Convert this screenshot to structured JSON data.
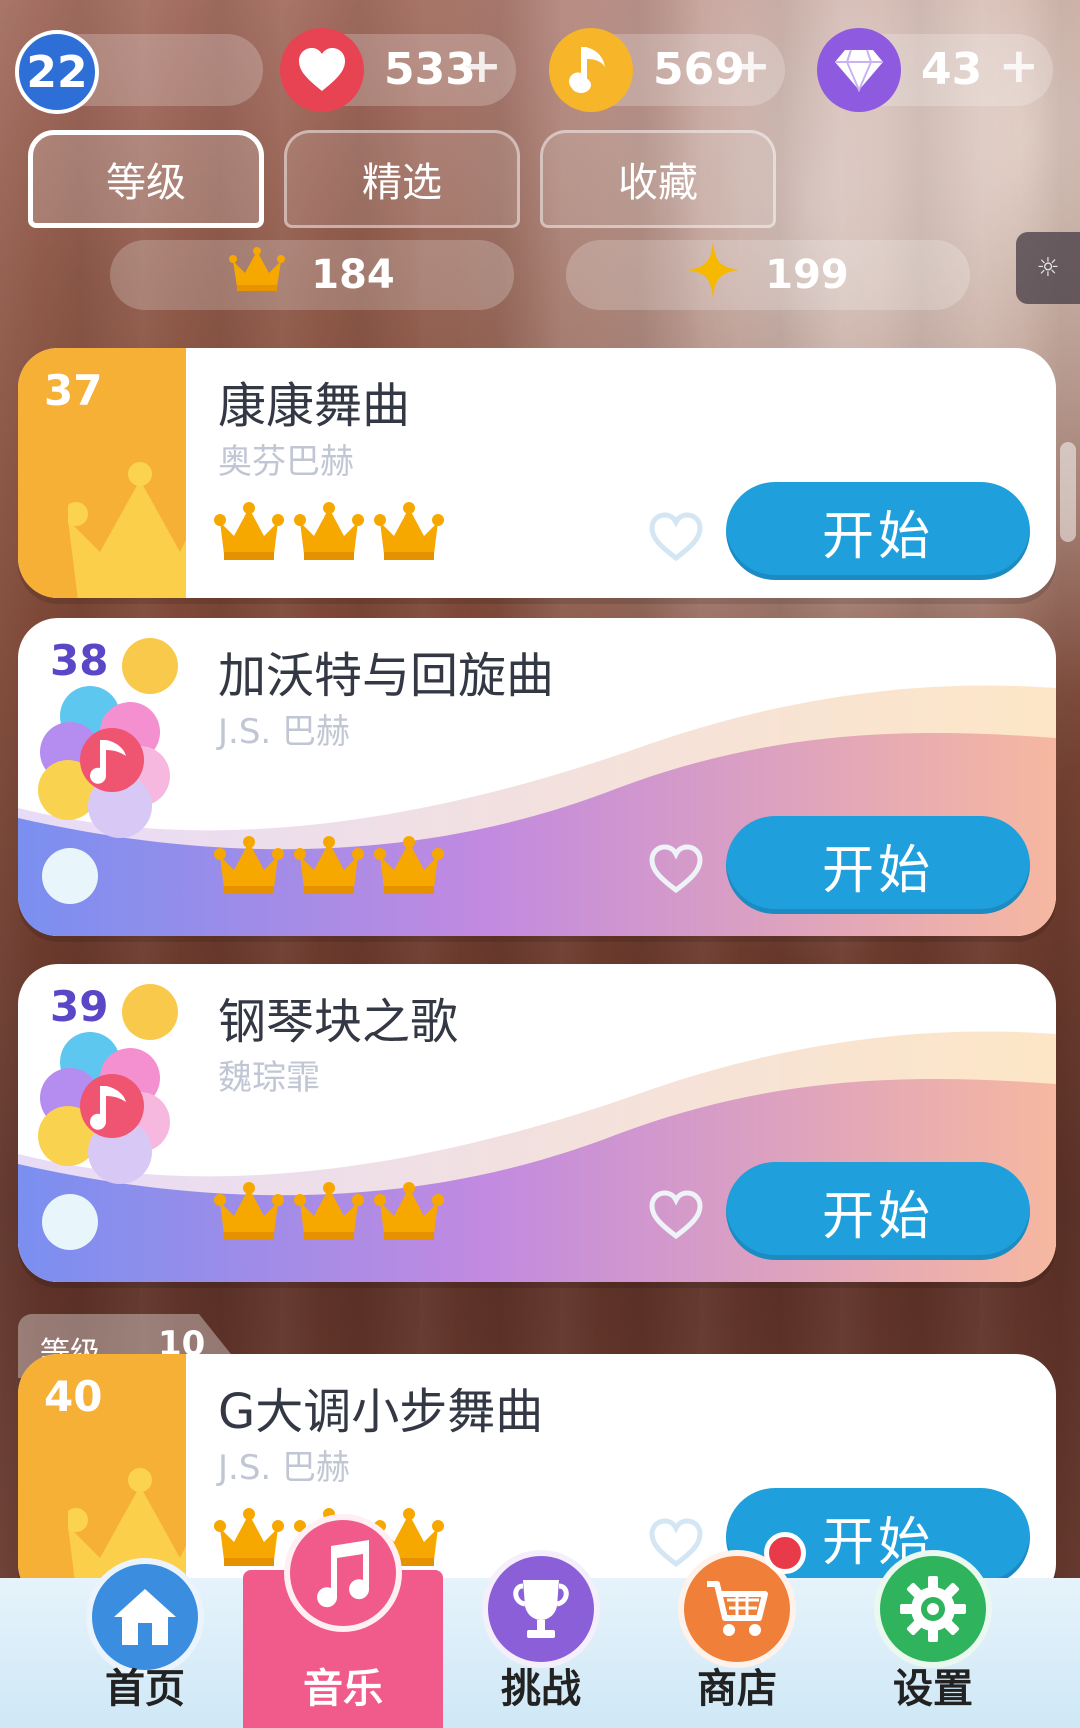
{
  "status": {
    "level": "22",
    "lives": {
      "value": "533",
      "plus": "+",
      "color": "#e84352"
    },
    "notes": {
      "value": "569",
      "plus": "+",
      "color": "#f7b52a"
    },
    "gems": {
      "value": "43",
      "plus": "+",
      "color": "#8e5ae0"
    }
  },
  "tabs": [
    {
      "label": "等级"
    },
    {
      "label": "精选"
    },
    {
      "label": "收藏"
    }
  ],
  "totals": {
    "crowns": "184",
    "stars": "199"
  },
  "songs": [
    {
      "num": "37",
      "title": "康康舞曲",
      "artist": "奥芬巴赫",
      "crowns": 3,
      "start": "开始"
    },
    {
      "num": "38",
      "title": "加沃特与回旋曲",
      "artist": "J.S. 巴赫",
      "crowns": 3,
      "start": "开始"
    },
    {
      "num": "39",
      "title": "钢琴块之歌",
      "artist": "魏琮霏",
      "crowns": 3,
      "start": "开始"
    },
    {
      "num": "40",
      "title": "G大调小步舞曲",
      "artist": "J.S. 巴赫",
      "crowns": 3,
      "start": "开始"
    }
  ],
  "level_tag": {
    "label": "等级",
    "value": "10"
  },
  "nav": [
    {
      "label": "首页",
      "icon": "home-icon",
      "color": "#3b8de0"
    },
    {
      "label": "音乐",
      "icon": "music-note-icon",
      "color": "#f05b8c"
    },
    {
      "label": "挑战",
      "icon": "trophy-icon",
      "color": "#8b5fd8"
    },
    {
      "label": "商店",
      "icon": "cart-icon",
      "color": "#f07f3a"
    },
    {
      "label": "设置",
      "icon": "gear-icon",
      "color": "#2fb35c"
    }
  ],
  "colors": {
    "accent_blue": "#1f9fdc",
    "crown_gold": "#f7a800",
    "card_orange": "#f7b036"
  }
}
